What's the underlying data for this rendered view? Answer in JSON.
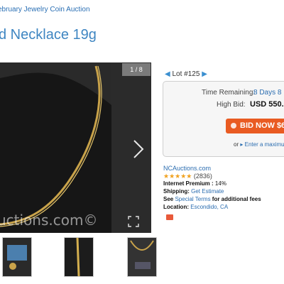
{
  "breadcrumb": "ebruary Jewelry Coin Auction",
  "page_title": "d Necklace 19g",
  "gallery": {
    "counter": "1 / 8",
    "watermark": "uctions.com©"
  },
  "lot": {
    "label": "Lot #125"
  },
  "bid_box": {
    "time_remaining_label": "Time Remaining:",
    "time_remaining_value": "8 Days 8 H",
    "high_bid_label": "High Bid:",
    "high_bid_value": "USD 550.0",
    "bid_button_label": "BID NOW $6",
    "or_text": "or",
    "max_bid_link": "Enter a maximu"
  },
  "seller": {
    "name": "NCAuctions.com",
    "stars": "★★★★★",
    "rating_count": "(2836)",
    "internet_premium_label": "Internet Premium :",
    "internet_premium_value": "14%",
    "shipping_label": "Shipping:",
    "shipping_link": "Get Estimate",
    "see_text": "See",
    "special_terms_link": "Special Terms",
    "additional_fees_text": "for additional fees",
    "location_label": "Location:",
    "location_value": "Escondido, CA"
  },
  "colors": {
    "accent": "#3f86c2",
    "bid_button": "#e95b22",
    "link": "#2b6db0"
  }
}
